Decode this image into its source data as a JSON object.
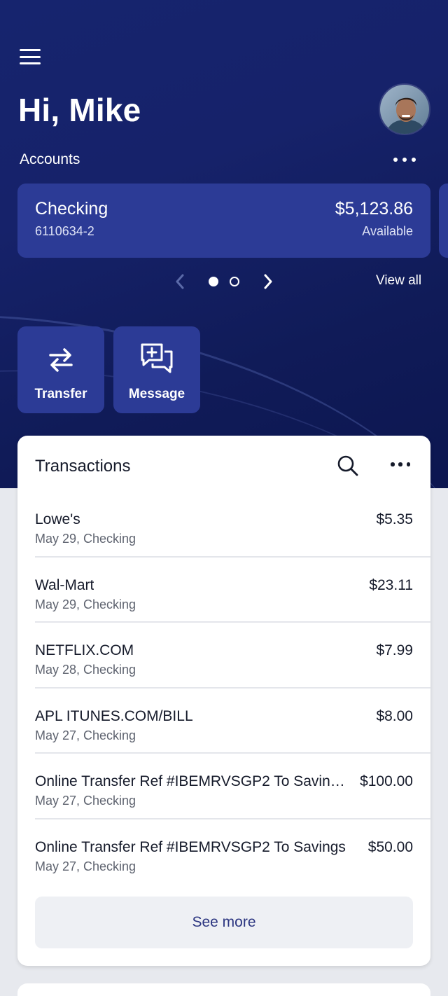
{
  "header": {
    "menu_icon": "hamburger-menu-icon",
    "greeting": "Hi, Mike",
    "avatar": "user-avatar-photo"
  },
  "accounts": {
    "label": "Accounts",
    "more_icon": "more-horizontal-icon",
    "cards": [
      {
        "name": "Checking",
        "number": "6110634-2",
        "balance": "$5,123.86",
        "balance_label": "Available"
      }
    ],
    "pager": {
      "current": 1,
      "total": 2
    },
    "view_all": "View all"
  },
  "actions": [
    {
      "label": "Transfer",
      "icon": "transfer-arrows-icon"
    },
    {
      "label": "Message",
      "icon": "message-add-icon"
    }
  ],
  "transactions": {
    "title": "Transactions",
    "search_icon": "search-icon",
    "more_icon": "more-horizontal-icon",
    "items": [
      {
        "merchant": "Lowe's",
        "meta": "May 29, Checking",
        "amount": "$5.35"
      },
      {
        "merchant": "Wal-Mart",
        "meta": "May 29, Checking",
        "amount": "$23.11"
      },
      {
        "merchant": "NETFLIX.COM",
        "meta": "May 28, Checking",
        "amount": "$7.99"
      },
      {
        "merchant": "APL ITUNES.COM/BILL",
        "meta": "May 27, Checking",
        "amount": "$8.00"
      },
      {
        "merchant": "Online Transfer Ref #IBEMRVSGP2 To Savin…",
        "meta": "May 27, Checking",
        "amount": "$100.00"
      },
      {
        "merchant": "Online Transfer Ref #IBEMRVSGP2 To Savings",
        "meta": "May 27, Checking",
        "amount": "$50.00"
      }
    ],
    "see_more": "See more"
  },
  "colors": {
    "hero_bg": "#14206a",
    "card_bg": "#2c3b96",
    "page_bg": "#e7e9ee",
    "link_text": "#2b3580"
  }
}
